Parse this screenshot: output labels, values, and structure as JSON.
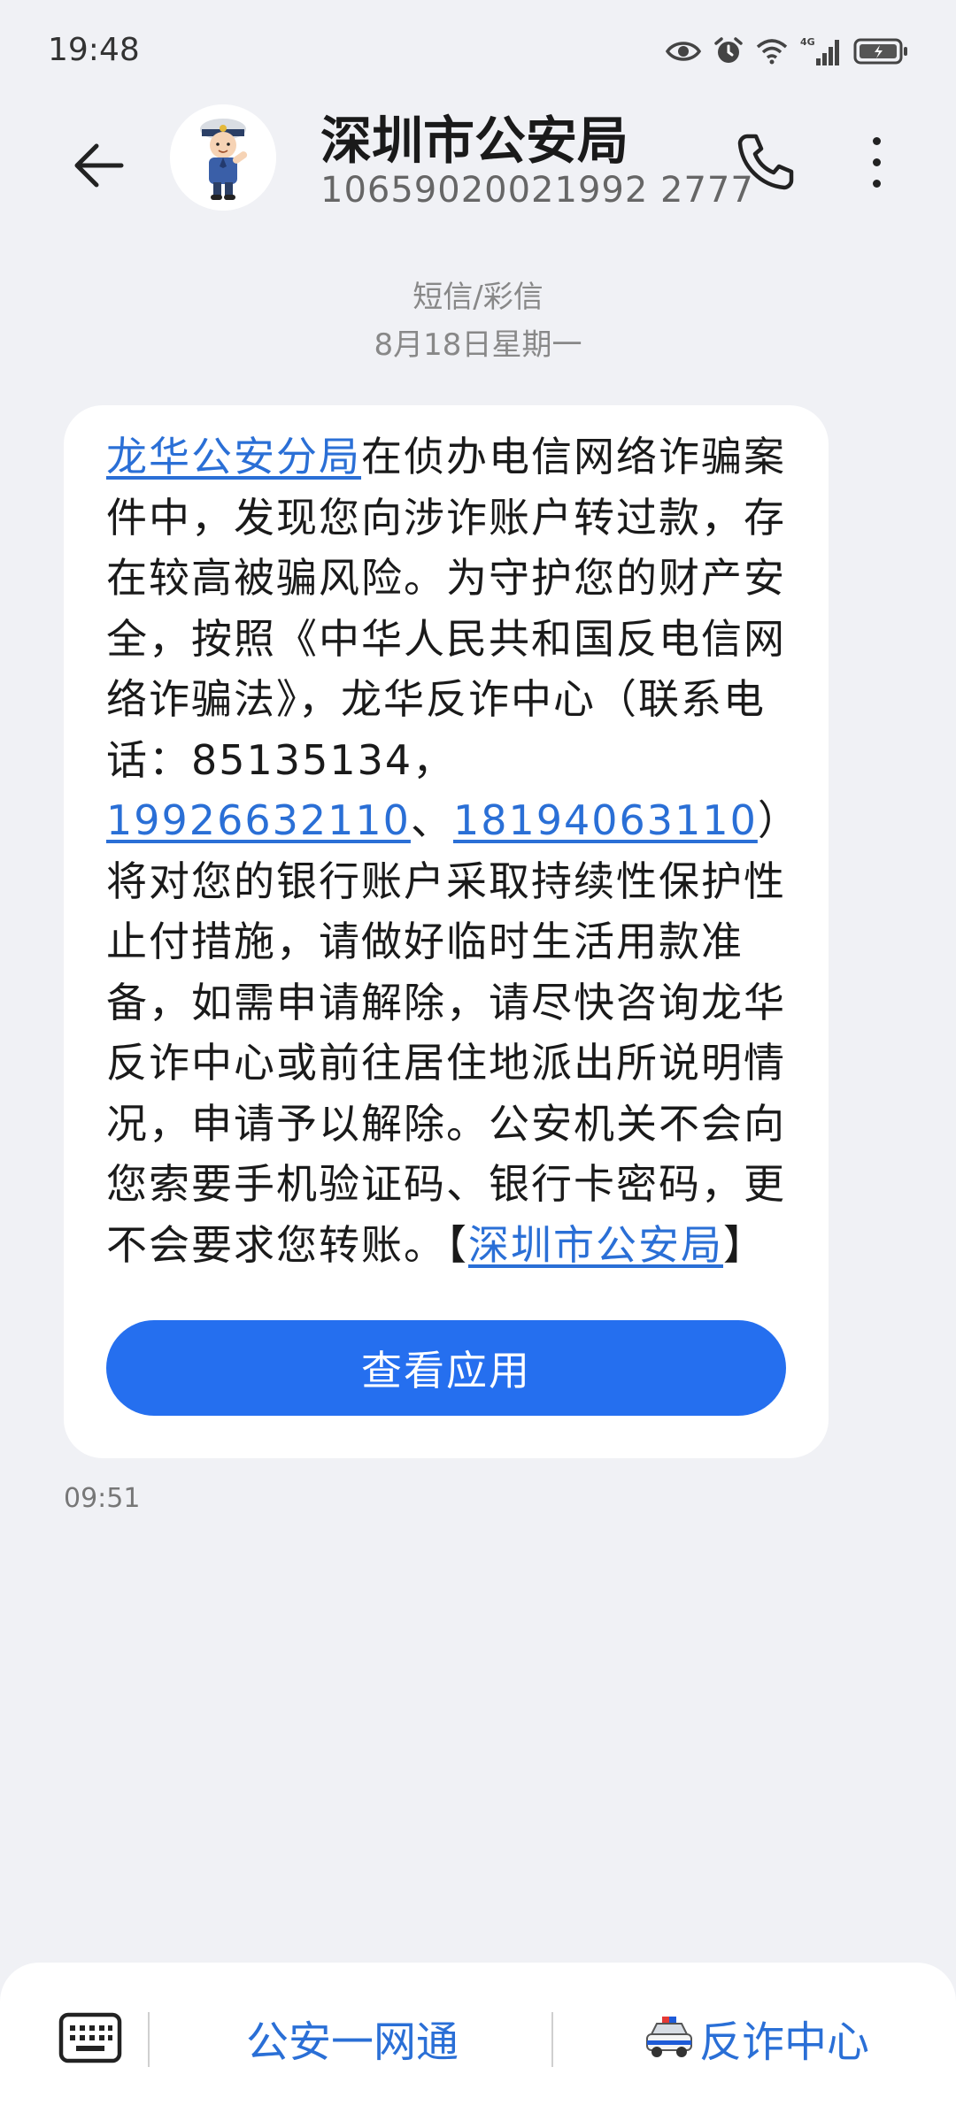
{
  "status_bar": {
    "time": "19:48",
    "icons": [
      "eye-icon",
      "alarm-icon",
      "wifi-icon",
      "signal-4g-icon",
      "battery-icon"
    ],
    "network_label": "4G"
  },
  "header": {
    "contact_name": "深圳市公安局",
    "contact_number": "10659020021992 2777",
    "back_icon": "back-arrow-icon",
    "call_icon": "phone-icon",
    "more_icon": "more-vertical-icon"
  },
  "thread": {
    "message_type": "短信/彩信",
    "date": "8月18日星期一"
  },
  "message": {
    "segments": [
      {
        "text": "龙华公安分局",
        "link": true
      },
      {
        "text": "在侦办电信网络诈骗案件中，发现您向涉诈账户转过款，存在较高被骗风险。为守护您的财产安全，按照《中华人民共和国反电信网络诈骗法》，龙华反诈中心（联系电话：85135134，",
        "link": false
      },
      {
        "text": "19926632110",
        "link": true
      },
      {
        "text": "、",
        "link": false
      },
      {
        "text": "18194063110",
        "link": true
      },
      {
        "text": "）将对您的银行账户采取持续性保护性止付措施，请做好临时生活用款准备，如需申请解除，请尽快咨询龙华反诈中心或前往居住地派出所说明情况，申请予以解除。公安机关不会向您索要手机验证码、银行卡密码，更不会要求您转账。【",
        "link": false
      },
      {
        "text": "深圳市公安局",
        "link": true
      },
      {
        "text": "】",
        "link": false
      }
    ],
    "button_label": "查看应用",
    "time": "09:51"
  },
  "bottom_bar": {
    "keyboard_icon": "keyboard-icon",
    "menu1": "公安一网通",
    "menu2_icon": "police-car-icon",
    "menu2": "反诈中心"
  },
  "colors": {
    "link": "#2a6fd6",
    "button": "#256fef",
    "background": "#f0f1f5"
  }
}
